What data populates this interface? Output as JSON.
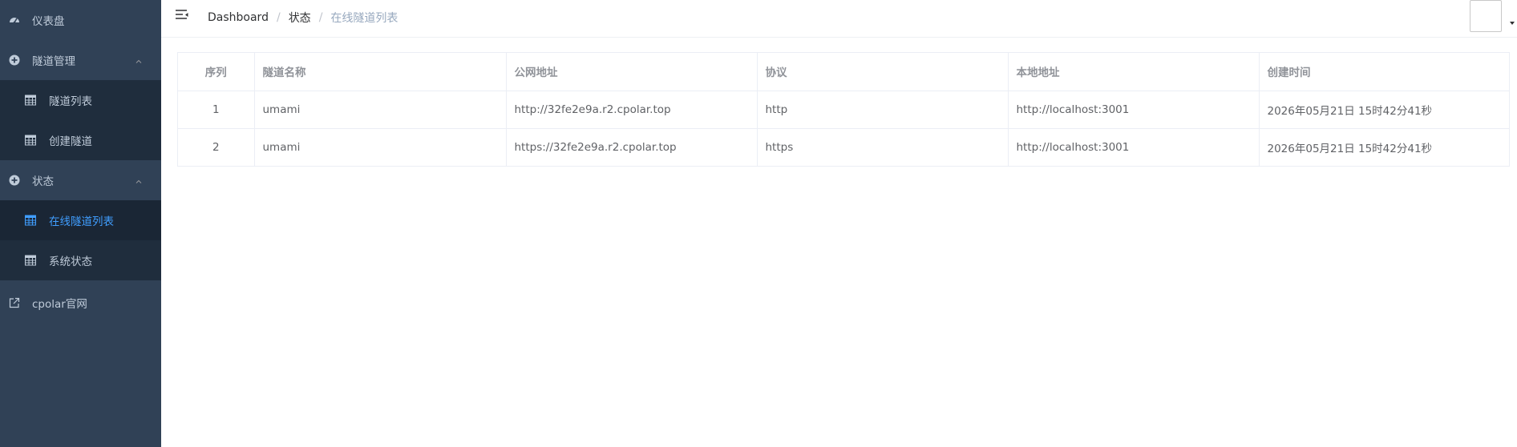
{
  "sidebar": {
    "dashboard": "仪表盘",
    "tunnel_mgmt": {
      "label": "隧道管理",
      "items": [
        "隧道列表",
        "创建隧道"
      ]
    },
    "status": {
      "label": "状态",
      "items": [
        "在线隧道列表",
        "系统状态"
      ]
    },
    "official_site": "cpolar官网"
  },
  "breadcrumb": {
    "items": [
      "Dashboard",
      "状态",
      "在线隧道列表"
    ],
    "separator": "/"
  },
  "table": {
    "headers": [
      "序列",
      "隧道名称",
      "公网地址",
      "协议",
      "本地地址",
      "创建时间"
    ],
    "rows": [
      [
        "1",
        "umami",
        "http://32fe2e9a.r2.cpolar.top",
        "http",
        "http://localhost:3001",
        "2026年05月21日 15时42分41秒"
      ],
      [
        "2",
        "umami",
        "https://32fe2e9a.r2.cpolar.top",
        "https",
        "http://localhost:3001",
        "2026年05月21日 15时42分41秒"
      ]
    ]
  },
  "colors": {
    "sidebar_bg": "#304156",
    "submenu_bg": "#1f2d3d",
    "active": "#409eff",
    "menu_text": "#bfcbd9"
  }
}
